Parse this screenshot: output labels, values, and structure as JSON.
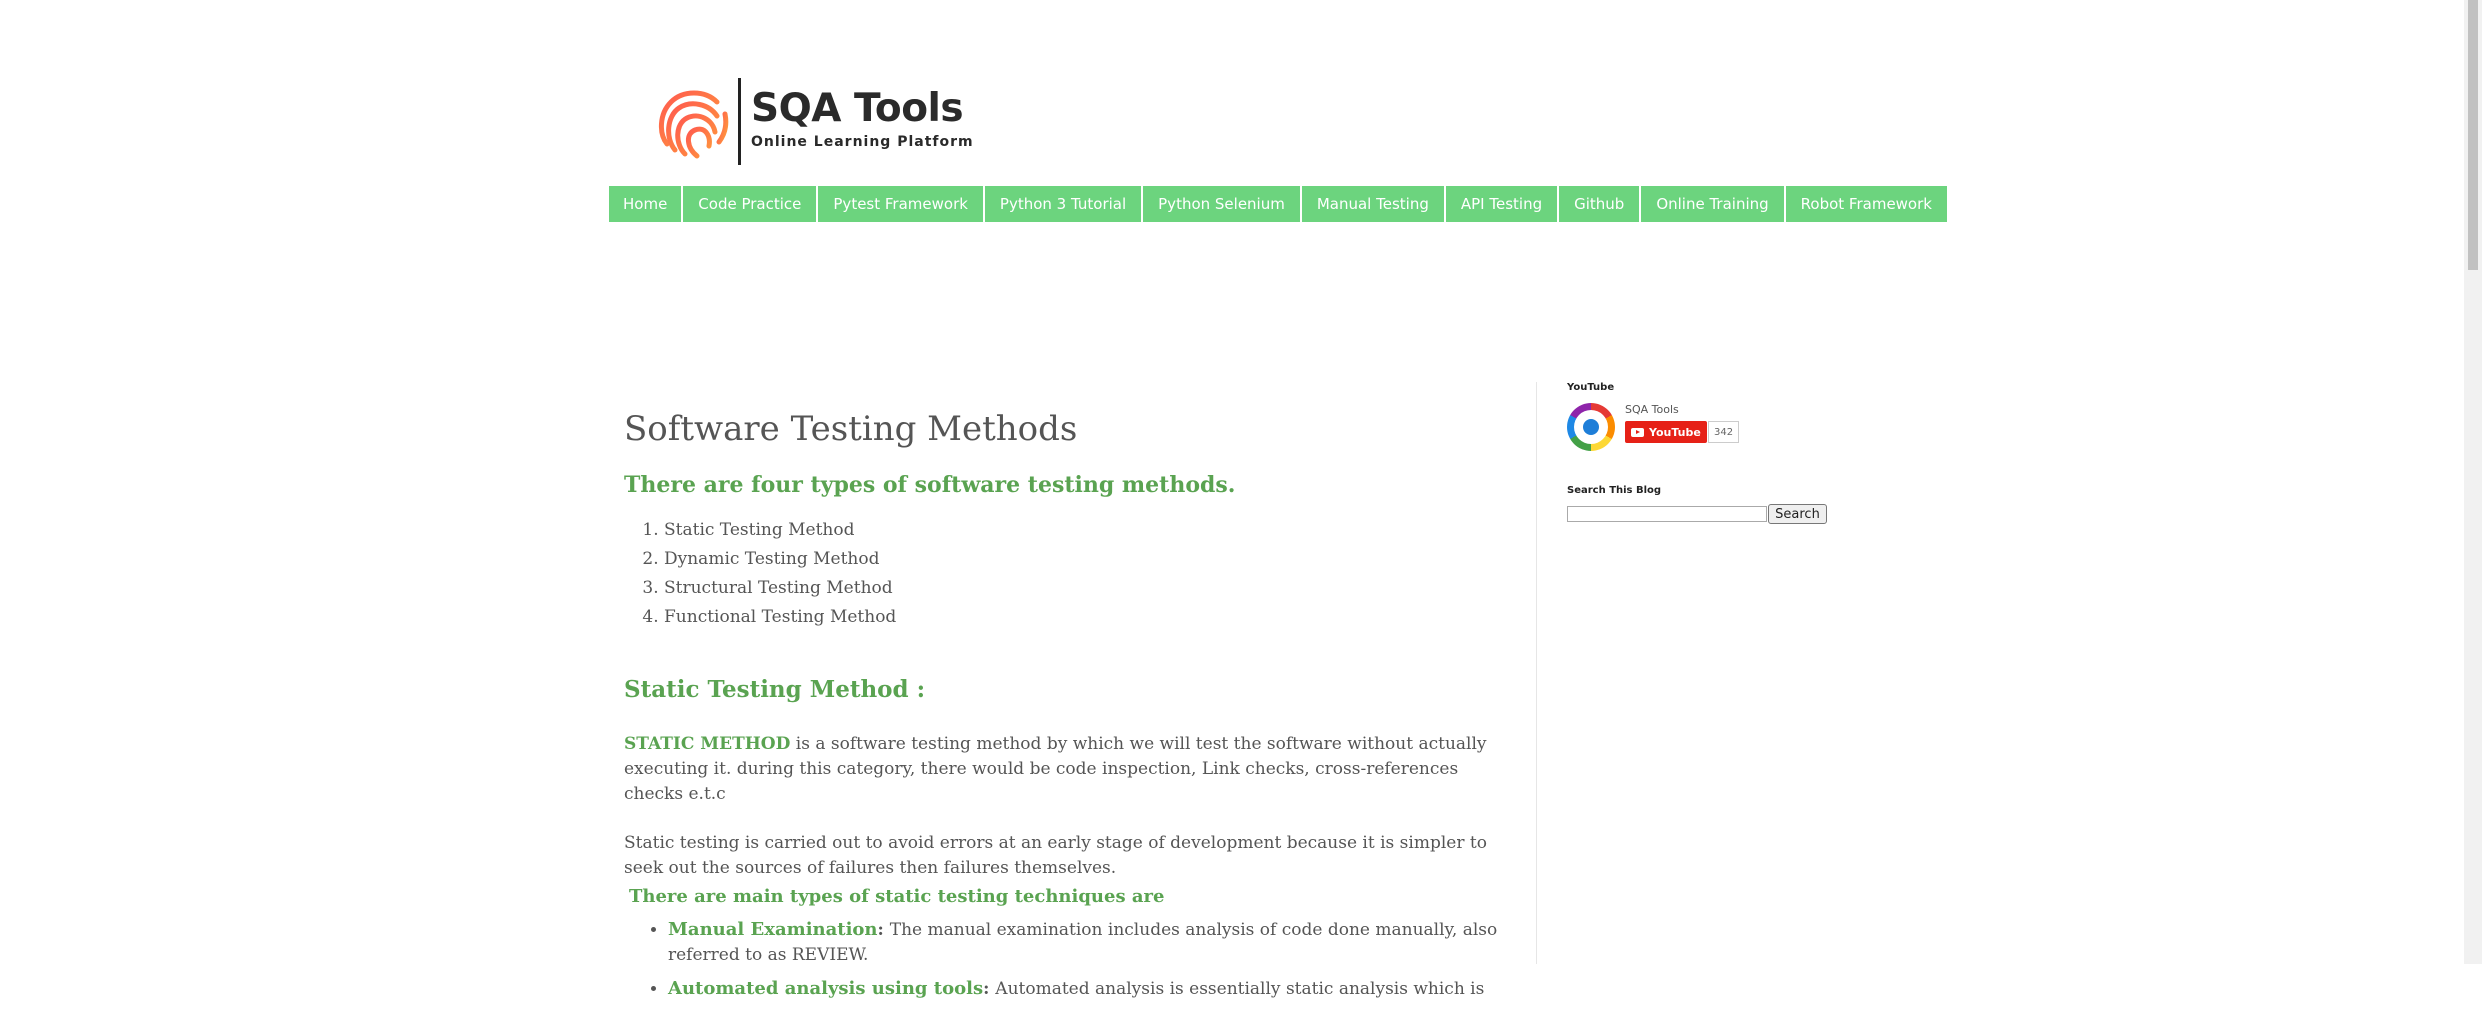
{
  "brand": {
    "title": "SQA Tools",
    "tagline": "Online Learning Platform"
  },
  "nav": {
    "items": [
      {
        "label": "Home"
      },
      {
        "label": "Code Practice"
      },
      {
        "label": "Pytest Framework"
      },
      {
        "label": "Python 3 Tutorial"
      },
      {
        "label": "Python Selenium"
      },
      {
        "label": "Manual Testing"
      },
      {
        "label": "API Testing"
      },
      {
        "label": "Github"
      },
      {
        "label": "Online Training"
      },
      {
        "label": "Robot Framework"
      }
    ]
  },
  "post": {
    "title": "Software Testing Methods",
    "intro_heading": "There are four types of software testing methods.",
    "methods": [
      "Static Testing Method",
      "Dynamic Testing Method",
      "Structural Testing Method",
      "Functional Testing Method"
    ],
    "section_heading": "Static Testing Method :",
    "static_lead": "STATIC METHOD",
    "static_text": " is a software testing method by which we will test the software without actually executing it. during this category, there would be code inspection, Link checks, cross-references checks e.t.c",
    "static_para2": "Static testing is carried out to avoid errors at an early stage of development because it is simpler to seek out the sources of failures then failures themselves.",
    "techniques_heading": "There are main types of static testing techniques are",
    "techniques": [
      {
        "term": "Manual Examination",
        "sep": ": ",
        "text": "The manual examination includes analysis of code done manually, also referred to as REVIEW."
      },
      {
        "term": "Automated analysis using tools",
        "sep": ":  ",
        "text": "Automated analysis is essentially static analysis which is"
      }
    ]
  },
  "sidebar": {
    "youtube": {
      "title": "YouTube",
      "channel_name": "SQA Tools",
      "button_label": "YouTube",
      "subscriber_count": "342"
    },
    "search": {
      "title": "Search This Blog",
      "input_value": "",
      "button_label": "Search"
    }
  },
  "colors": {
    "nav_bg": "#6cd47e",
    "accent_green": "#5aa351",
    "youtube_red": "#e62117"
  }
}
